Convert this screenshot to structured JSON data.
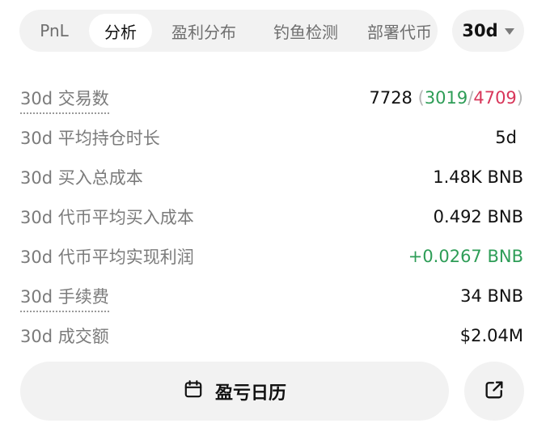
{
  "tabs": [
    {
      "label": "PnL",
      "active": false
    },
    {
      "label": "分析",
      "active": true
    },
    {
      "label": "盈利分布",
      "active": false
    },
    {
      "label": "钓鱼检测",
      "active": false
    },
    {
      "label": "部署代币",
      "active": false
    }
  ],
  "range_select": {
    "value": "30d",
    "icon": "chevron-down-icon"
  },
  "stats": {
    "trades": {
      "label": "30d 交易数",
      "total": "7728",
      "open_paren": "(",
      "wins": "3019",
      "slash": "/",
      "losses": "4709",
      "close_paren": ")"
    },
    "avg_hold": {
      "label": "30d 平均持仓时长",
      "value": "5d"
    },
    "total_cost": {
      "label": "30d 买入总成本",
      "value": "1.48K BNB"
    },
    "avg_token_cost": {
      "label": "30d 代币平均买入成本",
      "value": "0.492 BNB"
    },
    "avg_realized_profit": {
      "label": "30d 代币平均实现利润",
      "value": "+0.0267 BNB"
    },
    "fees": {
      "label": "30d 手续费",
      "value": "34 BNB"
    },
    "volume": {
      "label": "30d 成交额",
      "value": "$2.04M"
    }
  },
  "calendar_button": {
    "label": "盈亏日历",
    "icon": "calendar-icon"
  },
  "share_button": {
    "icon": "share-icon"
  },
  "colors": {
    "positive": "#2e9d57",
    "negative": "#d8365a",
    "muted": "#7b7b7b",
    "pill_bg": "#f2f2f2"
  }
}
